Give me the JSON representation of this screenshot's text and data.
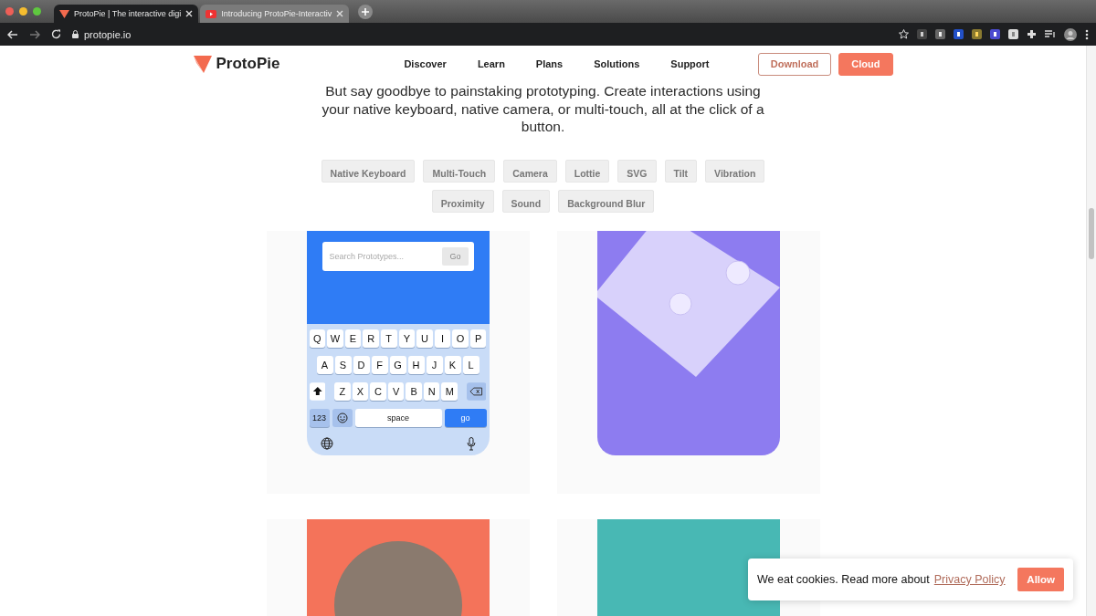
{
  "browser": {
    "tabs": [
      {
        "title": "ProtoPie | The interactive digi",
        "selected": true
      },
      {
        "title": "Introducing ProtoPie-Interactiv",
        "selected": false
      }
    ],
    "url": "protopie.io"
  },
  "nav": {
    "logo": "ProtoPie",
    "links": [
      "Discover",
      "Learn",
      "Plans",
      "Solutions",
      "Support"
    ],
    "buttons": [
      {
        "label": "Download",
        "kind": "outline"
      },
      {
        "label": "Cloud",
        "kind": "filled"
      }
    ]
  },
  "intro": {
    "text": "But say goodbye to painstaking prototyping. Create interactions using your native keyboard, native camera, or multi-touch, all at the click of a button."
  },
  "tags": [
    "Native Keyboard",
    "Multi-Touch",
    "Camera",
    "Lottie",
    "SVG",
    "Tilt",
    "Vibration",
    "Proximity",
    "Sound",
    "Background Blur"
  ],
  "demos": [
    {
      "kind": "keyboard",
      "search": {
        "placeholder": "Search Prototypes...",
        "button": "Go"
      },
      "keyboard": {
        "rows": [
          [
            "Q",
            "W",
            "E",
            "R",
            "T",
            "Y",
            "U",
            "I",
            "O",
            "P"
          ],
          [
            "A",
            "S",
            "D",
            "F",
            "G",
            "H",
            "J",
            "K",
            "L"
          ],
          [
            "Z",
            "X",
            "C",
            "V",
            "B",
            "N",
            "M"
          ]
        ],
        "numbers": "123",
        "space": "space",
        "go": "go"
      }
    },
    {
      "kind": "tilt"
    },
    {
      "kind": "camera"
    },
    {
      "kind": "plain"
    }
  ],
  "cookie": {
    "text": "We eat cookies. Read more about",
    "link": "Privacy Policy",
    "button": "Allow"
  }
}
